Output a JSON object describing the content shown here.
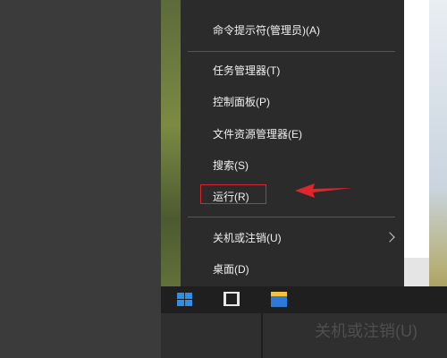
{
  "menu": {
    "items": [
      {
        "label": "命令提示符(管理员)(A)"
      },
      {
        "label": "任务管理器(T)"
      },
      {
        "label": "控制面板(P)"
      },
      {
        "label": "文件资源管理器(E)"
      },
      {
        "label": "搜索(S)"
      },
      {
        "label": "运行(R)"
      },
      {
        "label": "关机或注销(U)"
      },
      {
        "label": "桌面(D)"
      }
    ]
  },
  "annotation": {
    "highlight_color": "#d7262e",
    "arrow_color": "#e0262b"
  },
  "taskbar": {
    "icons": [
      "windows-start-icon",
      "task-view-icon",
      "file-explorer-icon"
    ]
  },
  "zoom_label": "关机或注销(U)",
  "colors": {
    "menu_bg": "#2b2b2b",
    "taskbar_bg": "#1f1f1f",
    "windows_blue": "#2f8fe6"
  }
}
